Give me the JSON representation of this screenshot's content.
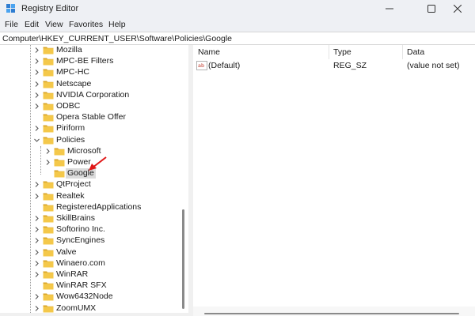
{
  "window": {
    "title": "Registry Editor",
    "minimize_glyph": "—",
    "maximize_glyph": "☐",
    "close_glyph": "✕"
  },
  "menu": [
    "File",
    "Edit",
    "View",
    "Favorites",
    "Help"
  ],
  "address": "Computer\\HKEY_CURRENT_USER\\Software\\Policies\\Google",
  "tree": {
    "items": [
      {
        "label": "Mozilla",
        "chevron": "right",
        "depth": 0
      },
      {
        "label": "MPC-BE Filters",
        "chevron": "right",
        "depth": 0
      },
      {
        "label": "MPC-HC",
        "chevron": "right",
        "depth": 0
      },
      {
        "label": "Netscape",
        "chevron": "right",
        "depth": 0
      },
      {
        "label": "NVIDIA Corporation",
        "chevron": "right",
        "depth": 0
      },
      {
        "label": "ODBC",
        "chevron": "right",
        "depth": 0
      },
      {
        "label": "Opera Stable Offer",
        "chevron": "none",
        "depth": 0
      },
      {
        "label": "Piriform",
        "chevron": "right",
        "depth": 0
      },
      {
        "label": "Policies",
        "chevron": "down",
        "depth": 0
      },
      {
        "label": "Microsoft",
        "chevron": "right",
        "depth": 1
      },
      {
        "label": "Power",
        "chevron": "right",
        "depth": 1
      },
      {
        "label": "Google",
        "chevron": "none",
        "depth": 1,
        "selected": true
      },
      {
        "label": "QtProject",
        "chevron": "right",
        "depth": 0
      },
      {
        "label": "Realtek",
        "chevron": "right",
        "depth": 0
      },
      {
        "label": "RegisteredApplications",
        "chevron": "none",
        "depth": 0
      },
      {
        "label": "SkillBrains",
        "chevron": "right",
        "depth": 0
      },
      {
        "label": "Softorino Inc.",
        "chevron": "right",
        "depth": 0
      },
      {
        "label": "SyncEngines",
        "chevron": "right",
        "depth": 0
      },
      {
        "label": "Valve",
        "chevron": "right",
        "depth": 0
      },
      {
        "label": "Winaero.com",
        "chevron": "right",
        "depth": 0
      },
      {
        "label": "WinRAR",
        "chevron": "right",
        "depth": 0
      },
      {
        "label": "WinRAR SFX",
        "chevron": "none",
        "depth": 0
      },
      {
        "label": "Wow6432Node",
        "chevron": "right",
        "depth": 0
      },
      {
        "label": "ZoomUMX",
        "chevron": "right",
        "depth": 0
      }
    ]
  },
  "list": {
    "columns": [
      "Name",
      "Type",
      "Data"
    ],
    "rows": [
      {
        "name": "(Default)",
        "type": "REG_SZ",
        "data": "(value not set)",
        "icon": "string-value-icon"
      }
    ]
  },
  "colors": {
    "folder": "#f4c84a",
    "folder_dark": "#d9a52a",
    "selection": "#dcdcdc",
    "arrow": "#e01818",
    "chrome": "#eef0f4"
  }
}
